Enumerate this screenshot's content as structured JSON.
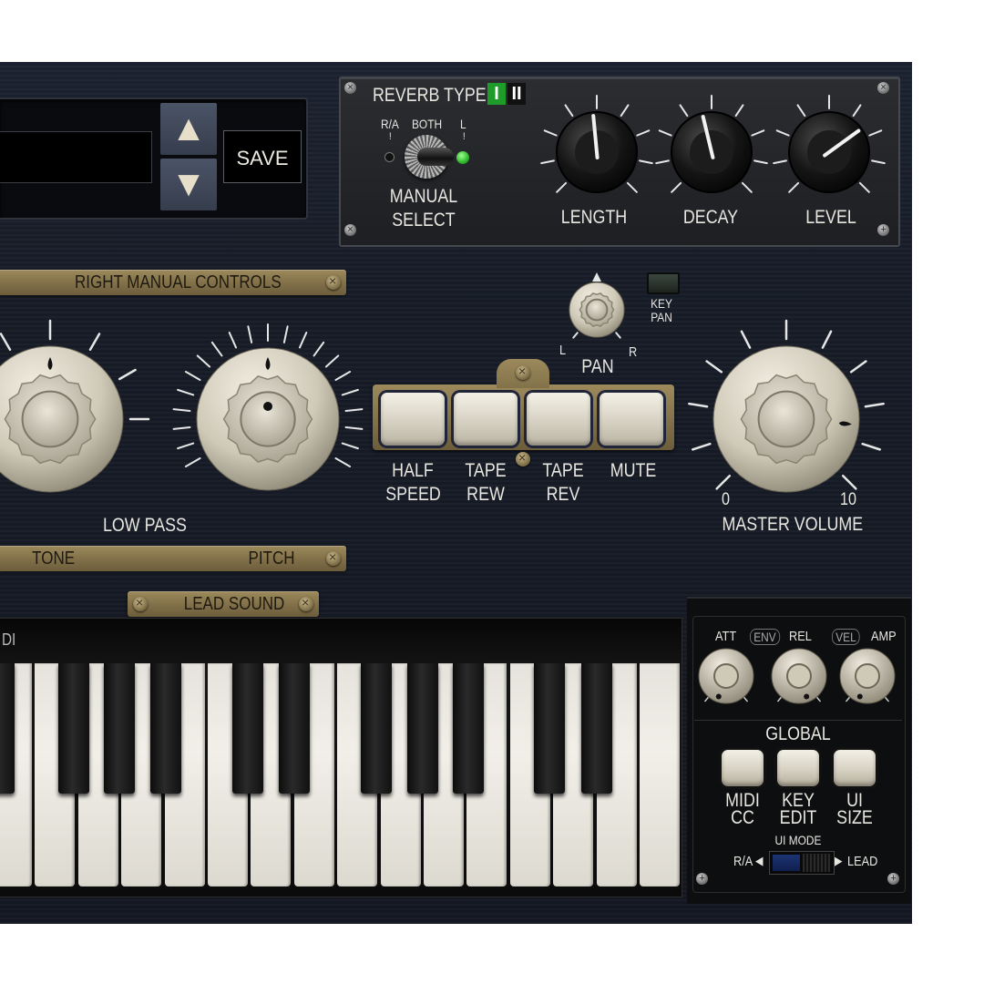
{
  "preset": {
    "save_label": "SAVE",
    "up_label": "▲",
    "down_label": "▼"
  },
  "reverb": {
    "title": "REVERB TYPE",
    "type_options": [
      "I",
      "II"
    ],
    "selected_type": "I",
    "switch_positions": [
      "R/A",
      "BOTH",
      "L"
    ],
    "switch_ticks": [
      "!",
      "!"
    ],
    "manual_select_label": [
      "MANUAL",
      "SELECT"
    ],
    "knobs": [
      {
        "label": "LENGTH",
        "value_fraction": 0.48
      },
      {
        "label": "DECAY",
        "value_fraction": 0.45
      },
      {
        "label": "LEVEL",
        "value_fraction": 0.7
      }
    ]
  },
  "right_manual": {
    "title": "RIGHT MANUAL CONTROLS",
    "low_pass_label": "LOW PASS",
    "tone_label": "TONE",
    "pitch_label": "PITCH"
  },
  "pan": {
    "label": "PAN",
    "left": "L",
    "right": "R",
    "key_pan_label": [
      "KEY",
      "PAN"
    ]
  },
  "tape_buttons": [
    {
      "label": [
        "HALF",
        "SPEED"
      ]
    },
    {
      "label": [
        "TAPE",
        "REW"
      ]
    },
    {
      "label": [
        "TAPE",
        "REV"
      ]
    },
    {
      "label": [
        "MUTE",
        ""
      ]
    }
  ],
  "master_volume": {
    "label": "MASTER VOLUME",
    "min": "0",
    "max": "10",
    "value": 8.5
  },
  "lead_sound": {
    "title": "LEAD SOUND",
    "keyboard_label": "DI"
  },
  "envelope": {
    "att": "ATT",
    "env": "ENV",
    "rel": "REL",
    "vel": "VEL",
    "amp": "AMP"
  },
  "global": {
    "title": "GLOBAL",
    "buttons": [
      {
        "label": [
          "MIDI",
          "CC"
        ]
      },
      {
        "label": [
          "KEY",
          "EDIT"
        ]
      },
      {
        "label": [
          "UI",
          "SIZE"
        ]
      }
    ],
    "ui_mode_label": "UI MODE",
    "ui_mode_left": "R/A",
    "ui_mode_right": "LEAD",
    "arrow_left": "◀",
    "arrow_right": "▶"
  },
  "colors": {
    "panel": "#171c27",
    "knob_cream": "#d9d4c6",
    "plaque": "#83714a",
    "led_green": "#3fc73a",
    "reverb_active": "#1f9b2a"
  }
}
